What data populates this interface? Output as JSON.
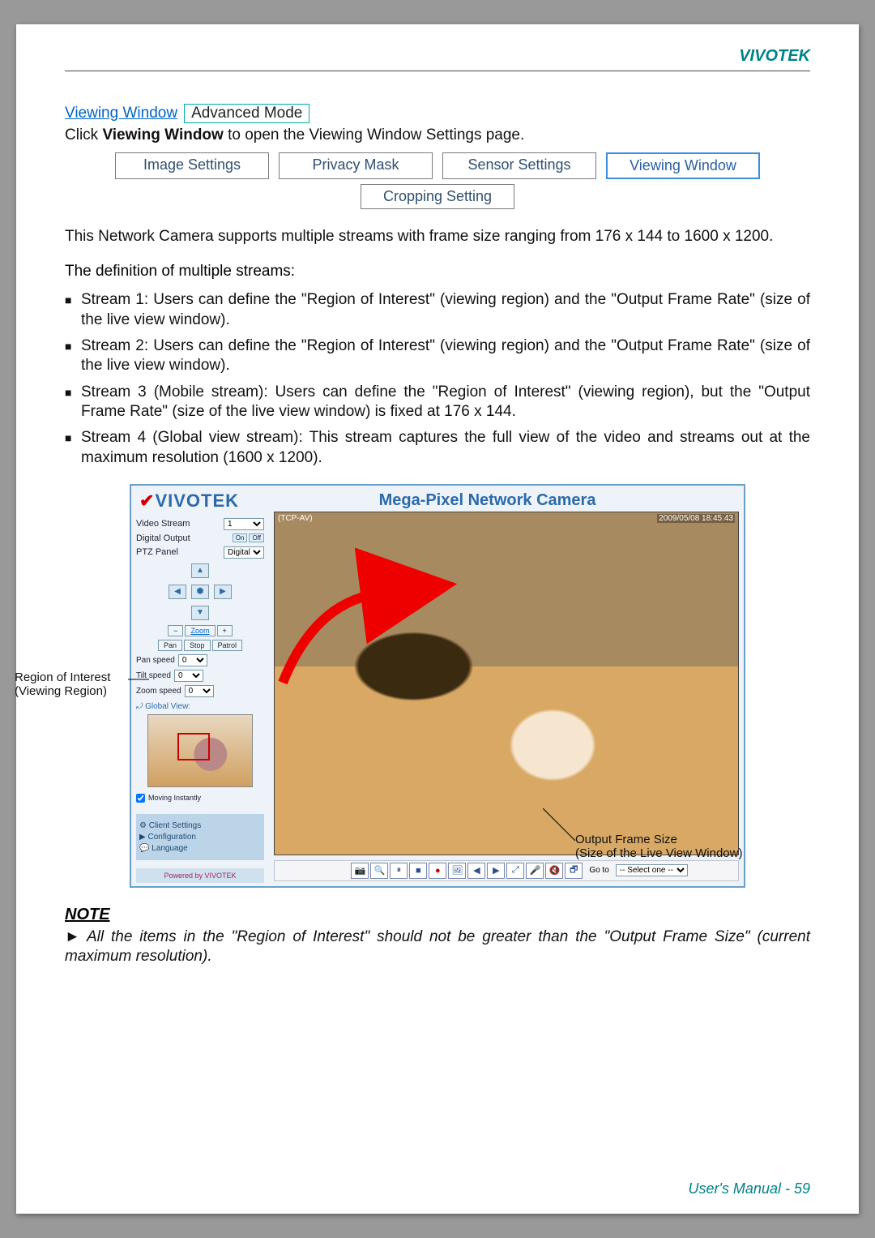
{
  "header": {
    "brand": "VIVOTEK"
  },
  "title_row": {
    "link": "Viewing Window",
    "badge": "Advanced Mode"
  },
  "click_line": {
    "pre": "Click ",
    "bold": "Viewing Window",
    "post": " to open the Viewing Window Settings page."
  },
  "tabs": {
    "r1": [
      "Image Settings",
      "Privacy Mask",
      "Sensor Settings",
      "Viewing Window"
    ],
    "r2": [
      "Cropping Setting"
    ]
  },
  "para1": "This Network Camera supports multiple streams with frame size ranging from 176 x 144 to 1600 x 1200.",
  "def_title": "The definition of multiple streams:",
  "bullets": [
    "Stream 1: Users can define the \"Region of Interest\" (viewing region) and the \"Output Frame Rate\" (size of the live view window).",
    "Stream 2: Users can define the \"Region of Interest\" (viewing region) and the \"Output Frame Rate\" (size of the live view window).",
    "Stream 3 (Mobile stream): Users can define the \"Region of Interest\" (viewing region), but the \"Output Frame Rate\" (size of the live view window) is fixed at 176 x 144.",
    "Stream 4 (Global view stream): This stream captures the full view of the video and streams out at the maximum resolution (1600 x 1200)."
  ],
  "camera": {
    "logo": "VIVOTEK",
    "title": "Mega-Pixel Network Camera",
    "sidebar": {
      "video_stream_lbl": "Video Stream",
      "video_stream_val": "1",
      "digital_output_lbl": "Digital Output",
      "do_on": "On",
      "do_off": "Off",
      "ptz_lbl": "PTZ Panel",
      "ptz_val": "Digital",
      "zoom_minus": "−",
      "zoom_lbl": "Zoom",
      "zoom_plus": "+",
      "pan_btn": "Pan",
      "stop_btn": "Stop",
      "patrol_btn": "Patrol",
      "pan_speed_lbl": "Pan speed",
      "tilt_speed_lbl": "Tilt speed",
      "zoom_speed_lbl": "Zoom speed",
      "speed_val": "0",
      "global_view_lbl": "⤾ Global View:",
      "moving_lbl": "Moving Instantly",
      "menu": {
        "client": "⚙ Client Settings",
        "config": "▶ Configuration",
        "lang": "💬 Language"
      },
      "powered": "Powered by VIVOTEK"
    },
    "video": {
      "left_badge": "(TCP-AV)",
      "timestamp": "2009/05/08 18:45:43"
    },
    "toolbar": {
      "icons": [
        "📷",
        "🔍",
        "⏸",
        "■",
        "●",
        "🖼",
        "◀",
        "▶",
        "⤢",
        "🎤",
        "🔇",
        "🗗"
      ],
      "goto_lbl": "Go to",
      "goto_val": "-- Select one --"
    }
  },
  "annotations": {
    "roi": "Region of Interest\n(Viewing Region)",
    "ofs": "Output Frame Size\n(Size of the Live View Window)"
  },
  "note": {
    "title": "NOTE",
    "body": "All the items in the \"Region of Interest\" should not be greater than the \"Output Frame Size\" (current maximum resolution)."
  },
  "footer": {
    "label": "User's Manual - ",
    "page": "59"
  }
}
